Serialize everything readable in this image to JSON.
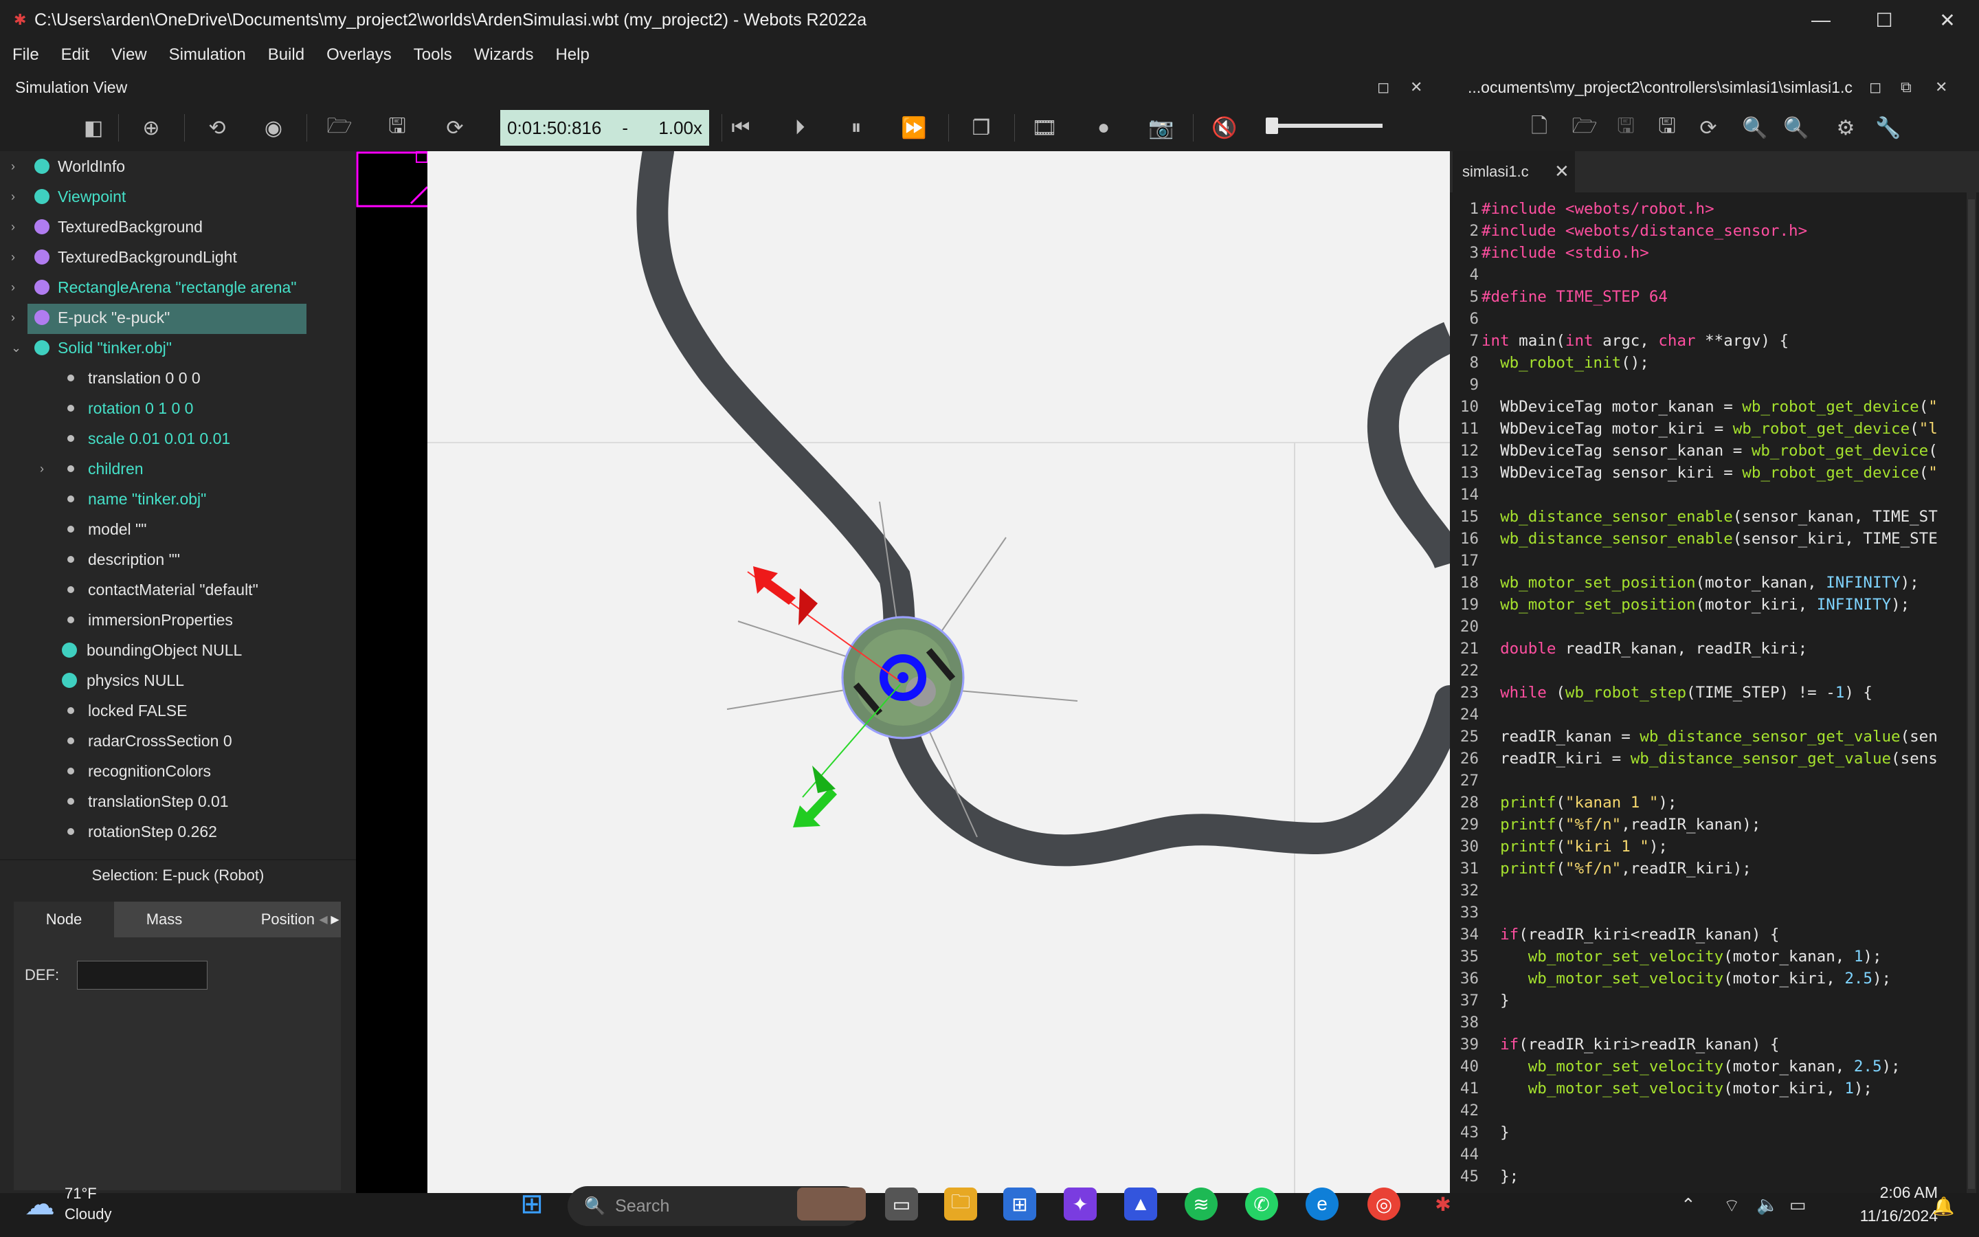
{
  "window": {
    "title": "C:\\Users\\arden\\OneDrive\\Documents\\my_project2\\worlds\\ArdenSimulasi.wbt (my_project2) - Webots R2022a"
  },
  "menu": [
    "File",
    "Edit",
    "View",
    "Simulation",
    "Build",
    "Overlays",
    "Tools",
    "Wizards",
    "Help"
  ],
  "sim_view": {
    "label": "Simulation View"
  },
  "editor_path": "...ocuments\\my_project2\\controllers\\simlasi1\\simlasi1.c",
  "toolbar": {
    "time": "0:01:50:816",
    "dash": "-",
    "speed": "1.00x"
  },
  "tree": {
    "items": [
      {
        "label": "WorldInfo",
        "color": "#3fd0c0",
        "text_color": "#e6e6e6"
      },
      {
        "label": "Viewpoint",
        "color": "#3fd0c0",
        "text_color": "#45e0c8"
      },
      {
        "label": "TexturedBackground",
        "color": "#b07cf0",
        "text_color": "#e6e6e6"
      },
      {
        "label": "TexturedBackgroundLight",
        "color": "#b07cf0",
        "text_color": "#e6e6e6"
      },
      {
        "label": "RectangleArena \"rectangle arena\"",
        "color": "#b07cf0",
        "text_color": "#45e0c8"
      },
      {
        "label": "E-puck \"e-puck\"",
        "color": "#b07cf0",
        "text_color": "#e6e6e6"
      },
      {
        "label": "Solid \"tinker.obj\"",
        "color": "#3fd0c0",
        "text_color": "#45e0c8"
      }
    ],
    "fields": [
      {
        "label": "translation 0 0 0",
        "text_color": "#e6e6e6"
      },
      {
        "label": "rotation 0 1 0 0",
        "text_color": "#45e0c8"
      },
      {
        "label": "scale 0.01 0.01 0.01",
        "text_color": "#45e0c8"
      },
      {
        "label": "children",
        "text_color": "#45e0c8"
      },
      {
        "label": "name \"tinker.obj\"",
        "text_color": "#45e0c8"
      },
      {
        "label": "model \"\"",
        "text_color": "#e6e6e6"
      },
      {
        "label": "description \"\"",
        "text_color": "#e6e6e6"
      },
      {
        "label": "contactMaterial \"default\"",
        "text_color": "#e6e6e6"
      },
      {
        "label": "immersionProperties",
        "text_color": "#e6e6e6"
      },
      {
        "label": "boundingObject NULL",
        "text_color": "#e6e6e6"
      },
      {
        "label": "physics NULL",
        "text_color": "#e6e6e6"
      },
      {
        "label": "locked FALSE",
        "text_color": "#e6e6e6"
      },
      {
        "label": "radarCrossSection 0",
        "text_color": "#e6e6e6"
      },
      {
        "label": "recognitionColors",
        "text_color": "#e6e6e6"
      },
      {
        "label": "translationStep 0.01",
        "text_color": "#e6e6e6"
      },
      {
        "label": "rotationStep 0.262",
        "text_color": "#e6e6e6"
      }
    ]
  },
  "selection": "Selection: E-puck (Robot)",
  "props": {
    "tabs": [
      "Node",
      "Mass",
      "Position"
    ],
    "def_label": "DEF:"
  },
  "editor": {
    "tab": "simlasi1.c",
    "lines": [
      {
        "n": "1",
        "t": "#include <webots/robot.h>"
      },
      {
        "n": "2",
        "t": "#include <webots/distance_sensor.h>"
      },
      {
        "n": "3",
        "t": "#include <stdio.h>"
      },
      {
        "n": "4",
        "t": ""
      },
      {
        "n": "5",
        "t": "#define TIME_STEP 64"
      },
      {
        "n": "6",
        "t": ""
      },
      {
        "n": "7",
        "t": "int main(int argc, char **argv) {"
      },
      {
        "n": "8",
        "t": "  wb_robot_init();"
      },
      {
        "n": "9",
        "t": ""
      },
      {
        "n": "10",
        "t": "  WbDeviceTag motor_kanan = wb_robot_get_device(\""
      },
      {
        "n": "11",
        "t": "  WbDeviceTag motor_kiri = wb_robot_get_device(\"l"
      },
      {
        "n": "12",
        "t": "  WbDeviceTag sensor_kanan = wb_robot_get_device("
      },
      {
        "n": "13",
        "t": "  WbDeviceTag sensor_kiri = wb_robot_get_device(\""
      },
      {
        "n": "14",
        "t": ""
      },
      {
        "n": "15",
        "t": "  wb_distance_sensor_enable(sensor_kanan, TIME_ST"
      },
      {
        "n": "16",
        "t": "  wb_distance_sensor_enable(sensor_kiri, TIME_STE"
      },
      {
        "n": "17",
        "t": ""
      },
      {
        "n": "18",
        "t": "  wb_motor_set_position(motor_kanan, INFINITY);"
      },
      {
        "n": "19",
        "t": "  wb_motor_set_position(motor_kiri, INFINITY);"
      },
      {
        "n": "20",
        "t": ""
      },
      {
        "n": "21",
        "t": "  double readIR_kanan, readIR_kiri;"
      },
      {
        "n": "22",
        "t": ""
      },
      {
        "n": "23",
        "t": "  while (wb_robot_step(TIME_STEP) != -1) {"
      },
      {
        "n": "24",
        "t": ""
      },
      {
        "n": "25",
        "t": "  readIR_kanan = wb_distance_sensor_get_value(sen"
      },
      {
        "n": "26",
        "t": "  readIR_kiri = wb_distance_sensor_get_value(sens"
      },
      {
        "n": "27",
        "t": ""
      },
      {
        "n": "28",
        "t": "  printf(\"kanan 1 \");"
      },
      {
        "n": "29",
        "t": "  printf(\"%f/n\",readIR_kanan);"
      },
      {
        "n": "30",
        "t": "  printf(\"kiri 1 \");"
      },
      {
        "n": "31",
        "t": "  printf(\"%f/n\",readIR_kiri);"
      },
      {
        "n": "32",
        "t": ""
      },
      {
        "n": "33",
        "t": ""
      },
      {
        "n": "34",
        "t": "  if(readIR_kiri<readIR_kanan) {"
      },
      {
        "n": "35",
        "t": "     wb_motor_set_velocity(motor_kanan, 1);"
      },
      {
        "n": "36",
        "t": "     wb_motor_set_velocity(motor_kiri, 2.5);"
      },
      {
        "n": "37",
        "t": "  }"
      },
      {
        "n": "38",
        "t": ""
      },
      {
        "n": "39",
        "t": "  if(readIR_kiri>readIR_kanan) {"
      },
      {
        "n": "40",
        "t": "     wb_motor_set_velocity(motor_kanan, 2.5);"
      },
      {
        "n": "41",
        "t": "     wb_motor_set_velocity(motor_kiri, 1);"
      },
      {
        "n": "42",
        "t": ""
      },
      {
        "n": "43",
        "t": "  }"
      },
      {
        "n": "44",
        "t": ""
      },
      {
        "n": "45",
        "t": "  };"
      }
    ]
  },
  "taskbar": {
    "temp": "71°F",
    "condition": "Cloudy",
    "search_placeholder": "Search",
    "time": "2:06 AM",
    "date": "11/16/2024"
  },
  "colors": {
    "accent_selection": "#3f6f6a",
    "timebox": "#c8e6d8",
    "track": "#45484c"
  }
}
